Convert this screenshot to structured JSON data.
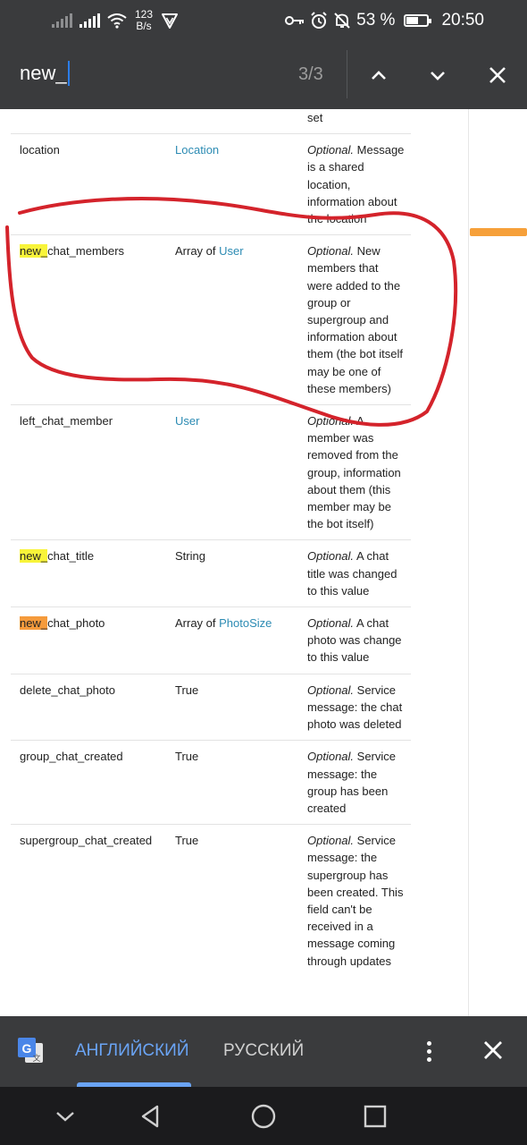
{
  "status_bar": {
    "net_speed_value": "123",
    "net_speed_unit": "B/s",
    "battery_percent": "53 %",
    "time": "20:50",
    "icons": [
      "signal-icon",
      "signal-icon",
      "wifi-icon",
      "vpn-icon",
      "key-icon",
      "alarm-icon",
      "mute-icon",
      "battery-icon"
    ]
  },
  "find_bar": {
    "query": "new_",
    "match_count": "3/3",
    "icons": [
      "chevron-up-icon",
      "chevron-down-icon",
      "close-icon"
    ]
  },
  "table": {
    "partial_top_text": "set",
    "rows": [
      {
        "field_match": "",
        "field_rest": "location",
        "type_prefix": "",
        "type_link": "Location",
        "desc_optional": "Optional.",
        "desc_rest": " Message is a shared location, information about the location"
      },
      {
        "field_match": "new_",
        "field_rest": "chat_members",
        "type_prefix": "Array of ",
        "type_link": "User",
        "desc_optional": "Optional.",
        "desc_rest": " New members that were added to the group or supergroup and information about them (the bot itself may be one of these members)"
      },
      {
        "field_match": "",
        "field_rest": "left_chat_member",
        "type_prefix": "",
        "type_link": "User",
        "desc_optional": "Optional.",
        "desc_rest": " A member was removed from the group, information about them (this member may be the bot itself)"
      },
      {
        "field_match": "new_",
        "field_rest": "chat_title",
        "type_prefix": "String",
        "type_link": "",
        "desc_optional": "Optional.",
        "desc_rest": " A chat title was changed to this value"
      },
      {
        "field_match": "new_",
        "field_rest": "chat_photo",
        "type_prefix": "Array of ",
        "type_link": "PhotoSize",
        "desc_optional": "Optional.",
        "desc_rest": " A chat photo was change to this value"
      },
      {
        "field_match": "",
        "field_rest": "delete_chat_photo",
        "type_prefix": "True",
        "type_link": "",
        "desc_optional": "Optional.",
        "desc_rest": " Service message: the chat photo was deleted"
      },
      {
        "field_match": "",
        "field_rest": "group_chat_created",
        "type_prefix": "True",
        "type_link": "",
        "desc_optional": "Optional.",
        "desc_rest": " Service message: the group has been created"
      },
      {
        "field_match": "",
        "field_rest": "supergroup_chat_created",
        "type_prefix": "True",
        "type_link": "",
        "desc_optional": "Optional.",
        "desc_rest": " Service message: the supergroup has been created. This field can't be received in a message coming through updates"
      }
    ]
  },
  "translate_bar": {
    "source_language": "АНГЛИЙСКИЙ",
    "target_language": "РУССКИЙ",
    "icons": [
      "google-translate-icon",
      "more-vert-icon",
      "close-icon"
    ]
  },
  "nav_bar": {
    "icons": [
      "nav-hide-icon",
      "nav-back-icon",
      "nav-home-icon",
      "nav-recents-icon"
    ]
  },
  "colors": {
    "bar_bg": "#3a3b3d",
    "link": "#2c8bb3",
    "match_highlight": "#f8f43a",
    "active_match_highlight": "#f59b3c",
    "annotation": "#d4232b",
    "selected_language": "#6aa4f5"
  }
}
